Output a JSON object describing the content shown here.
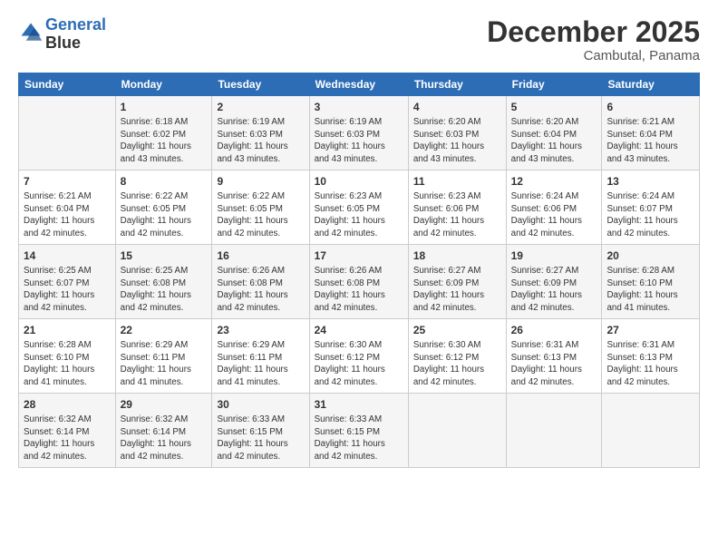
{
  "logo": {
    "line1": "General",
    "line2": "Blue"
  },
  "title": "December 2025",
  "subtitle": "Cambutal, Panama",
  "header_days": [
    "Sunday",
    "Monday",
    "Tuesday",
    "Wednesday",
    "Thursday",
    "Friday",
    "Saturday"
  ],
  "weeks": [
    [
      {
        "day": "",
        "sunrise": "",
        "sunset": "",
        "daylight": ""
      },
      {
        "day": "1",
        "sunrise": "Sunrise: 6:18 AM",
        "sunset": "Sunset: 6:02 PM",
        "daylight": "Daylight: 11 hours and 43 minutes."
      },
      {
        "day": "2",
        "sunrise": "Sunrise: 6:19 AM",
        "sunset": "Sunset: 6:03 PM",
        "daylight": "Daylight: 11 hours and 43 minutes."
      },
      {
        "day": "3",
        "sunrise": "Sunrise: 6:19 AM",
        "sunset": "Sunset: 6:03 PM",
        "daylight": "Daylight: 11 hours and 43 minutes."
      },
      {
        "day": "4",
        "sunrise": "Sunrise: 6:20 AM",
        "sunset": "Sunset: 6:03 PM",
        "daylight": "Daylight: 11 hours and 43 minutes."
      },
      {
        "day": "5",
        "sunrise": "Sunrise: 6:20 AM",
        "sunset": "Sunset: 6:04 PM",
        "daylight": "Daylight: 11 hours and 43 minutes."
      },
      {
        "day": "6",
        "sunrise": "Sunrise: 6:21 AM",
        "sunset": "Sunset: 6:04 PM",
        "daylight": "Daylight: 11 hours and 43 minutes."
      }
    ],
    [
      {
        "day": "7",
        "sunrise": "Sunrise: 6:21 AM",
        "sunset": "Sunset: 6:04 PM",
        "daylight": "Daylight: 11 hours and 42 minutes."
      },
      {
        "day": "8",
        "sunrise": "Sunrise: 6:22 AM",
        "sunset": "Sunset: 6:05 PM",
        "daylight": "Daylight: 11 hours and 42 minutes."
      },
      {
        "day": "9",
        "sunrise": "Sunrise: 6:22 AM",
        "sunset": "Sunset: 6:05 PM",
        "daylight": "Daylight: 11 hours and 42 minutes."
      },
      {
        "day": "10",
        "sunrise": "Sunrise: 6:23 AM",
        "sunset": "Sunset: 6:05 PM",
        "daylight": "Daylight: 11 hours and 42 minutes."
      },
      {
        "day": "11",
        "sunrise": "Sunrise: 6:23 AM",
        "sunset": "Sunset: 6:06 PM",
        "daylight": "Daylight: 11 hours and 42 minutes."
      },
      {
        "day": "12",
        "sunrise": "Sunrise: 6:24 AM",
        "sunset": "Sunset: 6:06 PM",
        "daylight": "Daylight: 11 hours and 42 minutes."
      },
      {
        "day": "13",
        "sunrise": "Sunrise: 6:24 AM",
        "sunset": "Sunset: 6:07 PM",
        "daylight": "Daylight: 11 hours and 42 minutes."
      }
    ],
    [
      {
        "day": "14",
        "sunrise": "Sunrise: 6:25 AM",
        "sunset": "Sunset: 6:07 PM",
        "daylight": "Daylight: 11 hours and 42 minutes."
      },
      {
        "day": "15",
        "sunrise": "Sunrise: 6:25 AM",
        "sunset": "Sunset: 6:08 PM",
        "daylight": "Daylight: 11 hours and 42 minutes."
      },
      {
        "day": "16",
        "sunrise": "Sunrise: 6:26 AM",
        "sunset": "Sunset: 6:08 PM",
        "daylight": "Daylight: 11 hours and 42 minutes."
      },
      {
        "day": "17",
        "sunrise": "Sunrise: 6:26 AM",
        "sunset": "Sunset: 6:08 PM",
        "daylight": "Daylight: 11 hours and 42 minutes."
      },
      {
        "day": "18",
        "sunrise": "Sunrise: 6:27 AM",
        "sunset": "Sunset: 6:09 PM",
        "daylight": "Daylight: 11 hours and 42 minutes."
      },
      {
        "day": "19",
        "sunrise": "Sunrise: 6:27 AM",
        "sunset": "Sunset: 6:09 PM",
        "daylight": "Daylight: 11 hours and 42 minutes."
      },
      {
        "day": "20",
        "sunrise": "Sunrise: 6:28 AM",
        "sunset": "Sunset: 6:10 PM",
        "daylight": "Daylight: 11 hours and 41 minutes."
      }
    ],
    [
      {
        "day": "21",
        "sunrise": "Sunrise: 6:28 AM",
        "sunset": "Sunset: 6:10 PM",
        "daylight": "Daylight: 11 hours and 41 minutes."
      },
      {
        "day": "22",
        "sunrise": "Sunrise: 6:29 AM",
        "sunset": "Sunset: 6:11 PM",
        "daylight": "Daylight: 11 hours and 41 minutes."
      },
      {
        "day": "23",
        "sunrise": "Sunrise: 6:29 AM",
        "sunset": "Sunset: 6:11 PM",
        "daylight": "Daylight: 11 hours and 41 minutes."
      },
      {
        "day": "24",
        "sunrise": "Sunrise: 6:30 AM",
        "sunset": "Sunset: 6:12 PM",
        "daylight": "Daylight: 11 hours and 42 minutes."
      },
      {
        "day": "25",
        "sunrise": "Sunrise: 6:30 AM",
        "sunset": "Sunset: 6:12 PM",
        "daylight": "Daylight: 11 hours and 42 minutes."
      },
      {
        "day": "26",
        "sunrise": "Sunrise: 6:31 AM",
        "sunset": "Sunset: 6:13 PM",
        "daylight": "Daylight: 11 hours and 42 minutes."
      },
      {
        "day": "27",
        "sunrise": "Sunrise: 6:31 AM",
        "sunset": "Sunset: 6:13 PM",
        "daylight": "Daylight: 11 hours and 42 minutes."
      }
    ],
    [
      {
        "day": "28",
        "sunrise": "Sunrise: 6:32 AM",
        "sunset": "Sunset: 6:14 PM",
        "daylight": "Daylight: 11 hours and 42 minutes."
      },
      {
        "day": "29",
        "sunrise": "Sunrise: 6:32 AM",
        "sunset": "Sunset: 6:14 PM",
        "daylight": "Daylight: 11 hours and 42 minutes."
      },
      {
        "day": "30",
        "sunrise": "Sunrise: 6:33 AM",
        "sunset": "Sunset: 6:15 PM",
        "daylight": "Daylight: 11 hours and 42 minutes."
      },
      {
        "day": "31",
        "sunrise": "Sunrise: 6:33 AM",
        "sunset": "Sunset: 6:15 PM",
        "daylight": "Daylight: 11 hours and 42 minutes."
      },
      {
        "day": "",
        "sunrise": "",
        "sunset": "",
        "daylight": ""
      },
      {
        "day": "",
        "sunrise": "",
        "sunset": "",
        "daylight": ""
      },
      {
        "day": "",
        "sunrise": "",
        "sunset": "",
        "daylight": ""
      }
    ]
  ]
}
